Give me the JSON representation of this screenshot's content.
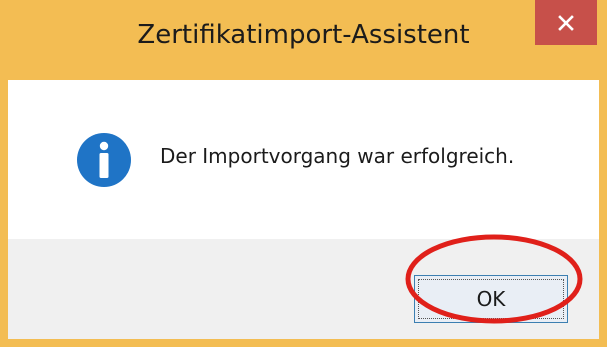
{
  "window": {
    "title": "Zertifikatimport-Assistent",
    "close_icon": "close-icon"
  },
  "dialog": {
    "icon": "info-icon",
    "message": "Der Importvorgang war erfolgreich."
  },
  "buttons": {
    "ok_label": "OK"
  },
  "annotation": {
    "highlight_color": "#e0201a"
  }
}
